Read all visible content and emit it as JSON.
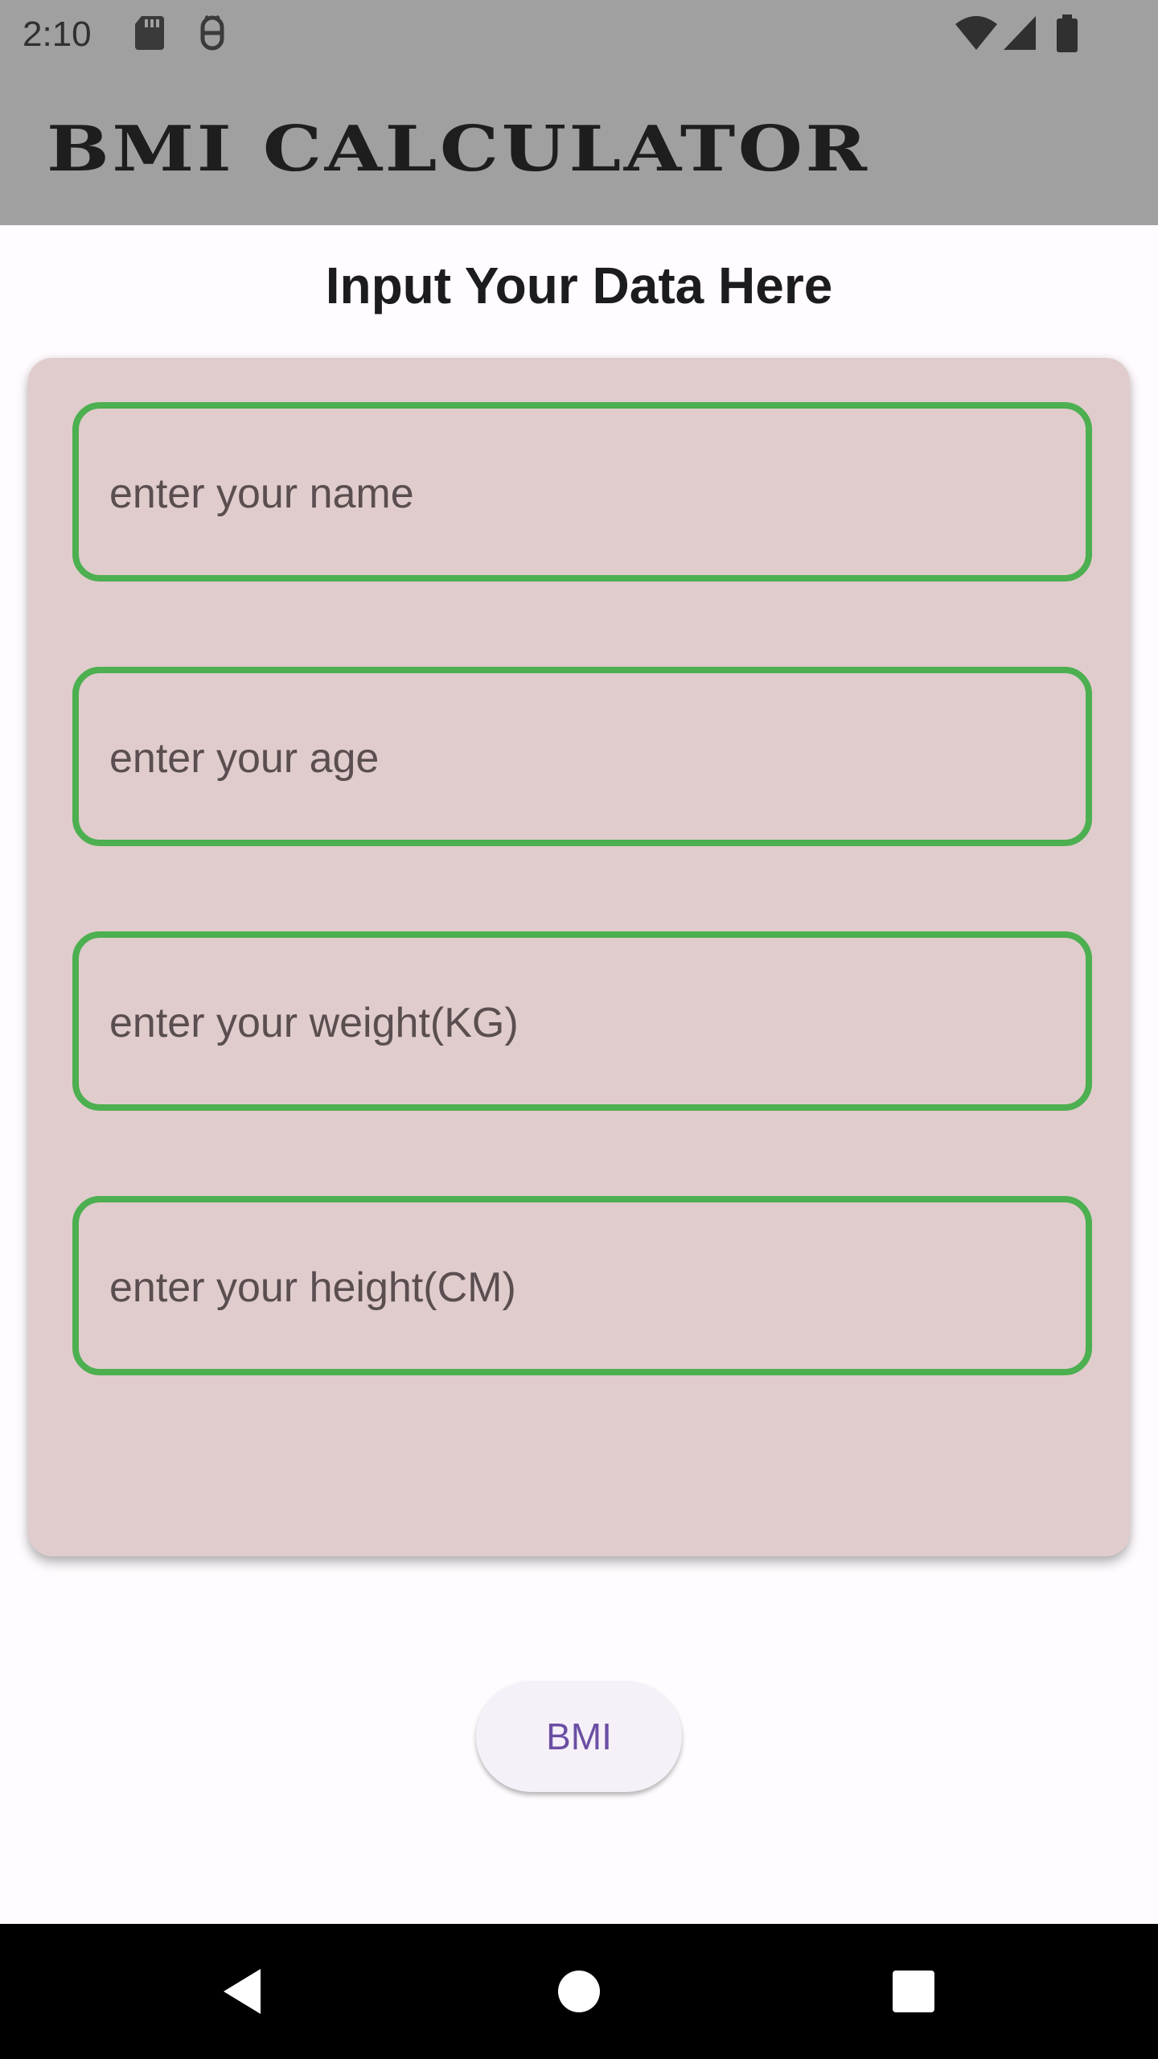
{
  "status_bar": {
    "time": "2:10",
    "icons": [
      "sd-card-icon",
      "bug-icon",
      "wifi-icon",
      "signal-icon",
      "battery-icon"
    ]
  },
  "app_bar": {
    "title": "BMI CALCULATOR"
  },
  "main": {
    "heading": "Input Your Data Here",
    "fields": [
      {
        "placeholder": "enter your name"
      },
      {
        "placeholder": "enter your age"
      },
      {
        "placeholder": "enter your weight(KG)"
      },
      {
        "placeholder": "enter your height(CM)"
      }
    ],
    "button_label": "BMI"
  },
  "nav_bar": {
    "icons": [
      "back-icon",
      "home-icon",
      "recents-icon"
    ]
  },
  "colors": {
    "app_bar": "#a0a0a0",
    "card": "#e0cccc",
    "field_border": "#4caf50",
    "button_text": "#6a4fa4"
  }
}
